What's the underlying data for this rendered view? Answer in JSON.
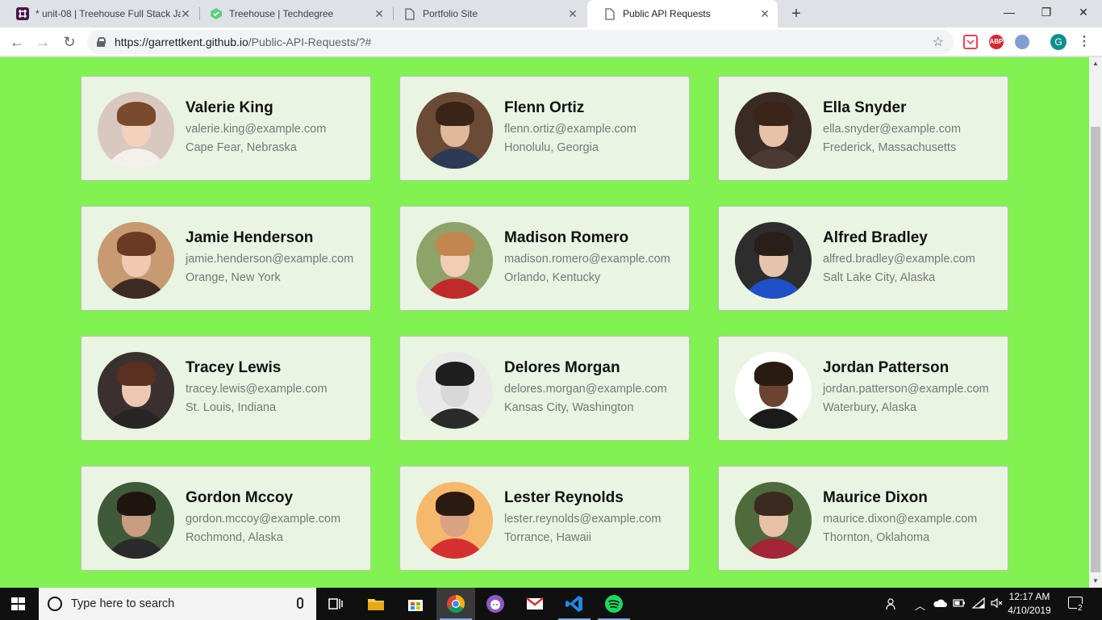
{
  "browser": {
    "tabs": [
      {
        "label": "* unit-08 | Treehouse Full Stack Ja",
        "icon": "slack-icon"
      },
      {
        "label": "Treehouse | Techdegree",
        "icon": "treehouse-icon"
      },
      {
        "label": "Portfolio Site",
        "icon": "page-icon"
      },
      {
        "label": "Public API Requests",
        "icon": "page-icon"
      }
    ],
    "new_tab": "+",
    "controls": {
      "minimize": "—",
      "restore": "❐",
      "close": "✕"
    },
    "nav": {
      "back": "←",
      "forward": "→",
      "reload": "↻"
    },
    "url_host": "https://garrettkent.github.io",
    "url_path": "/Public-API-Requests/?#",
    "bookmark": "☆",
    "extensions": [
      {
        "name": "pocket-extension-icon",
        "label": "",
        "color": "#ef4056"
      },
      {
        "name": "adblock-plus-icon",
        "label": "ABP",
        "color": "#d52a2f"
      },
      {
        "name": "extension-icon",
        "label": "",
        "color": "#7f9fd3"
      }
    ],
    "profile_initial": "G",
    "menu": "⋮"
  },
  "colors": {
    "page_background": "#82f152",
    "card_background": "#e9f4e3"
  },
  "employees": [
    {
      "name": "Valerie King",
      "email": "valerie.king@example.com",
      "location": "Cape Fear, Nebraska"
    },
    {
      "name": "Flenn Ortiz",
      "email": "flenn.ortiz@example.com",
      "location": "Honolulu, Georgia"
    },
    {
      "name": "Ella Snyder",
      "email": "ella.snyder@example.com",
      "location": "Frederick, Massachusetts"
    },
    {
      "name": "Jamie Henderson",
      "email": "jamie.henderson@example.com",
      "location": "Orange, New York"
    },
    {
      "name": "Madison Romero",
      "email": "madison.romero@example.com",
      "location": "Orlando, Kentucky"
    },
    {
      "name": "Alfred Bradley",
      "email": "alfred.bradley@example.com",
      "location": "Salt Lake City, Alaska"
    },
    {
      "name": "Tracey Lewis",
      "email": "tracey.lewis@example.com",
      "location": "St. Louis, Indiana"
    },
    {
      "name": "Delores Morgan",
      "email": "delores.morgan@example.com",
      "location": "Kansas City, Washington"
    },
    {
      "name": "Jordan Patterson",
      "email": "jordan.patterson@example.com",
      "location": "Waterbury, Alaska"
    },
    {
      "name": "Gordon Mccoy",
      "email": "gordon.mccoy@example.com",
      "location": "Rochmond, Alaska"
    },
    {
      "name": "Lester Reynolds",
      "email": "lester.reynolds@example.com",
      "location": "Torrance, Hawaii"
    },
    {
      "name": "Maurice Dixon",
      "email": "maurice.dixon@example.com",
      "location": "Thornton, Oklahoma"
    }
  ],
  "taskbar": {
    "search_placeholder": "Type here to search",
    "apps": [
      "task-view-icon",
      "file-explorer-icon",
      "store-icon",
      "chrome-icon",
      "github-desktop-icon",
      "gmail-icon",
      "vscode-icon",
      "spotify-icon"
    ],
    "time": "12:17 AM",
    "date": "4/10/2019",
    "notification_count": "2"
  }
}
